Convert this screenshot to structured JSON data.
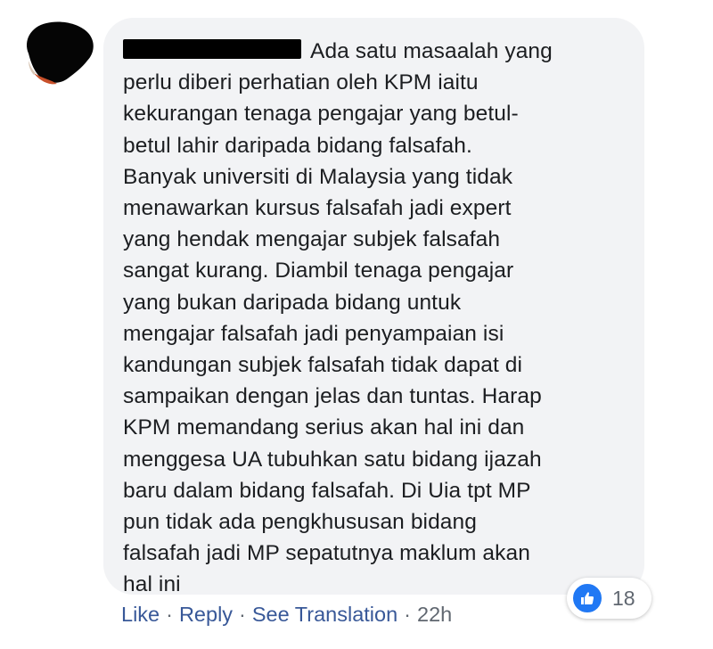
{
  "comment": {
    "lines": [
      "Ada satu masaalah yang",
      "perlu diberi perhatian oleh KPM iaitu",
      "kekurangan tenaga pengajar yang betul-",
      "betul lahir daripada bidang falsafah.",
      "Banyak universiti di Malaysia yang tidak",
      "menawarkan kursus falsafah jadi expert",
      "yang hendak mengajar subjek falsafah",
      "sangat kurang. Diambil tenaga pengajar",
      "yang bukan daripada bidang untuk",
      "mengajar falsafah jadi penyampaian isi",
      "kandungan subjek falsafah tidak dapat di",
      "sampaikan dengan jelas dan tuntas. Harap",
      "KPM memandang serius akan hal ini dan",
      "menggesa UA tubuhkan satu bidang ijazah",
      "baru dalam bidang falsafah. Di Uia tpt MP",
      "pun tidak ada pengkhususan bidang",
      "falsafah jadi MP sepatutnya maklum akan",
      "hal ini"
    ]
  },
  "reactions": {
    "icon": "thumbs-up-icon",
    "count": "18",
    "color": "#2078f4"
  },
  "actions": {
    "like": "Like",
    "reply": "Reply",
    "see_translation": "See Translation",
    "separator": "·",
    "time": "22h"
  },
  "colors": {
    "bubble_bg": "#f2f3f5",
    "text": "#1c1e21",
    "link": "#385898",
    "meta": "#606770"
  }
}
